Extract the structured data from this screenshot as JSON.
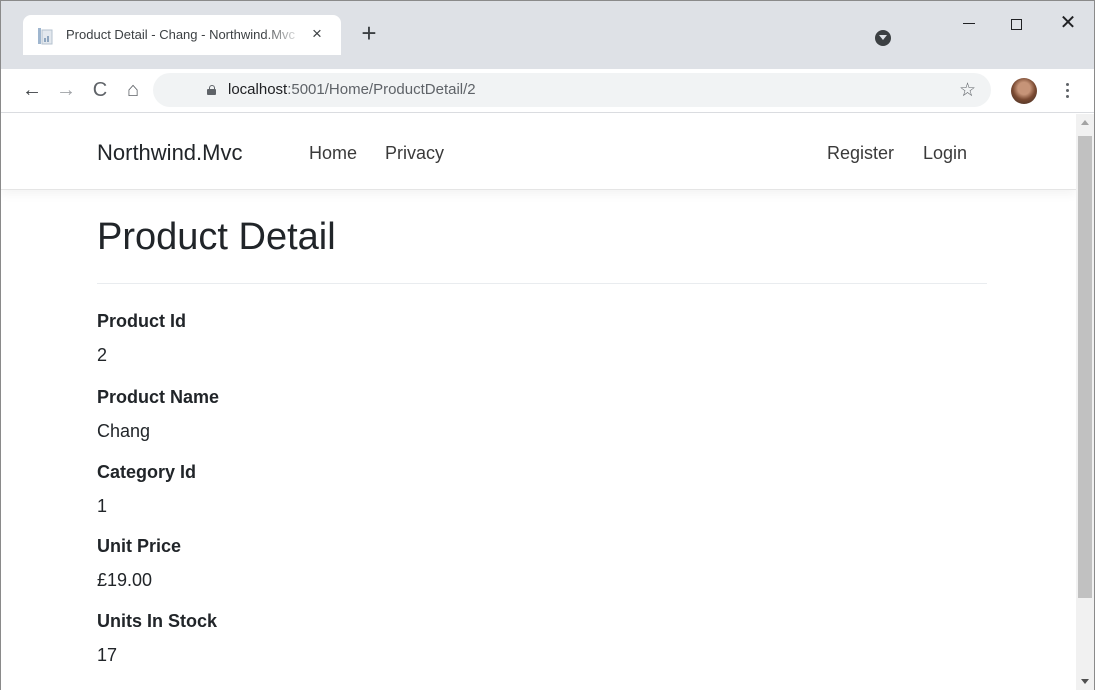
{
  "browser": {
    "tab_title": "Product Detail - Chang - Northwind.Mvc",
    "tab_close": "×",
    "new_tab": "+",
    "url_host": "localhost",
    "url_rest": ":5001/Home/ProductDetail/2",
    "icons": {
      "back": "arrow-left-icon",
      "forward": "arrow-right-icon",
      "reload": "reload-icon",
      "home": "home-icon",
      "lock": "lock-icon",
      "star": "star-icon",
      "menu": "kebab-menu-icon",
      "tab_search": "tab-search-icon"
    }
  },
  "site": {
    "brand": "Northwind.Mvc",
    "nav_left": [
      "Home",
      "Privacy"
    ],
    "nav_right": [
      "Register",
      "Login"
    ]
  },
  "page": {
    "title": "Product Detail",
    "fields": [
      {
        "label": "Product Id",
        "value": "2"
      },
      {
        "label": "Product Name",
        "value": "Chang"
      },
      {
        "label": "Category Id",
        "value": "1"
      },
      {
        "label": "Unit Price",
        "value": "£19.00"
      },
      {
        "label": "Units In Stock",
        "value": "17"
      }
    ]
  },
  "colors": {
    "tabstrip": "#dee1e6",
    "text": "#212529",
    "scroll_thumb": "#c1c1c1"
  }
}
